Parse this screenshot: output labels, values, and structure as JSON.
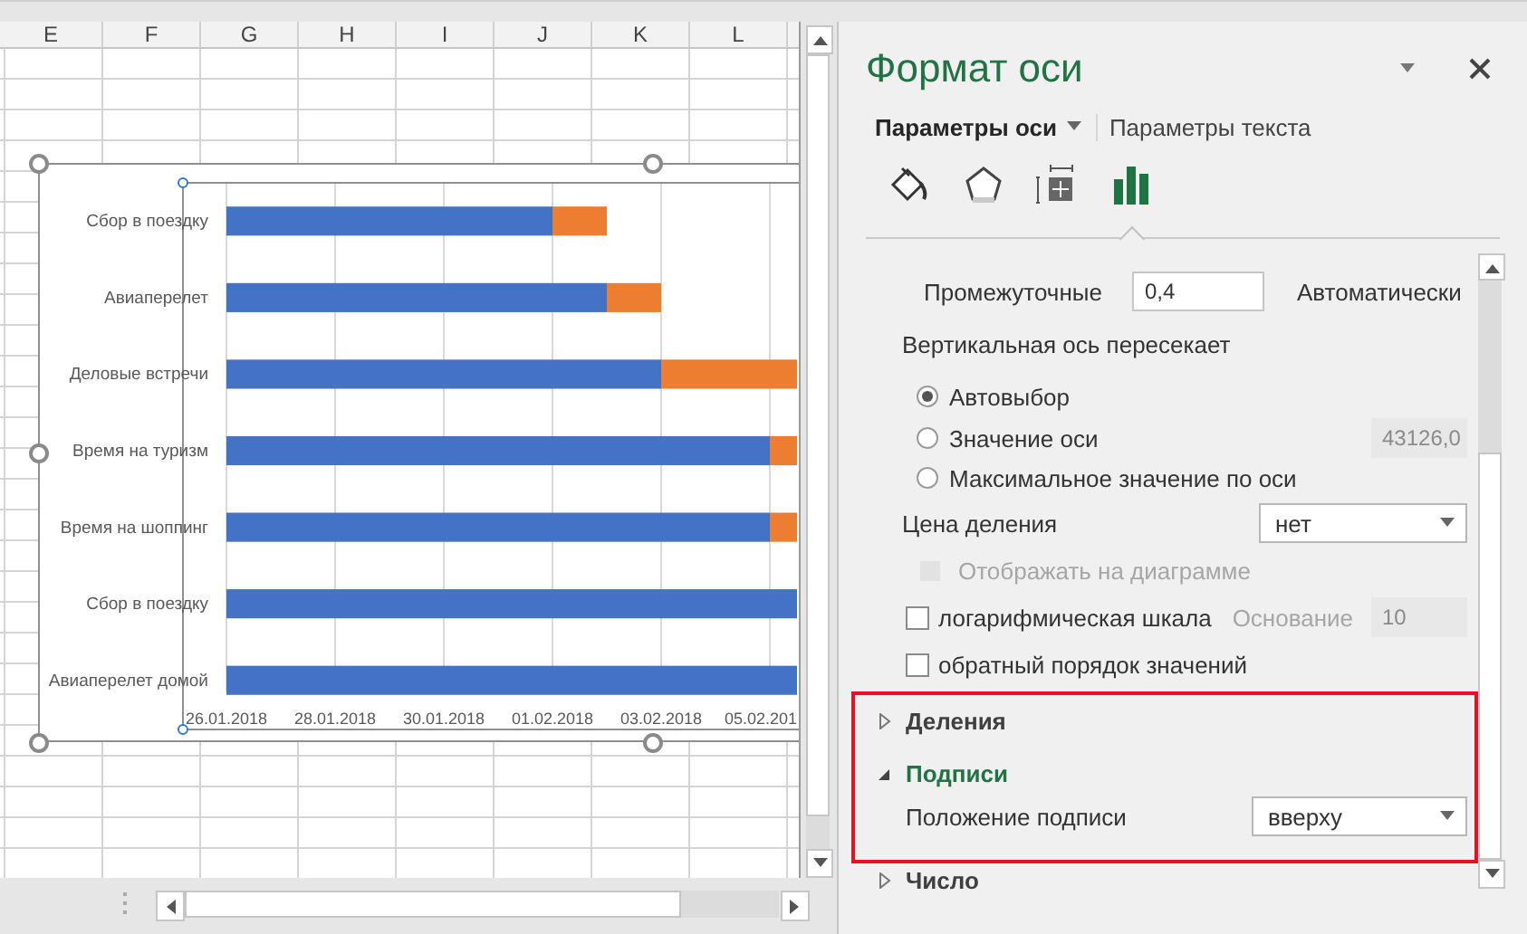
{
  "sheet": {
    "columns": [
      "E",
      "F",
      "G",
      "H",
      "I",
      "J",
      "K",
      "L"
    ]
  },
  "chart": {
    "categories": [
      "Сбор в поездку",
      "Авиаперелет",
      "Деловые встречи",
      "Время на туризм",
      "Время на шоппинг",
      "Сбор в поездку",
      "Авиаперелет домой"
    ],
    "axis_labels": [
      "26.01.2018",
      "28.01.2018",
      "30.01.2018",
      "01.02.2018",
      "03.02.2018",
      "05.02.201"
    ]
  },
  "panel": {
    "title": "Формат оси",
    "tabs": [
      {
        "label": "Параметры оси",
        "selected": true
      },
      {
        "label": "Параметры текста",
        "selected": false
      }
    ],
    "icon_tabs": [
      {
        "kind": "fill",
        "selected": false
      },
      {
        "kind": "effects",
        "selected": false
      },
      {
        "kind": "size",
        "selected": false
      },
      {
        "kind": "options",
        "selected": true
      }
    ],
    "options": [
      {
        "kind": "partial_field"
      },
      {
        "kind": "spin",
        "label": "Промежуточные",
        "field": {
          "value": "0,4",
          "disabled": false
        },
        "note": "Автоматически"
      },
      {
        "kind": "heading",
        "label": "Вертикальная ось пересекает"
      },
      {
        "kind": "radio",
        "label": "Автовыбор",
        "selected": true
      },
      {
        "kind": "radio",
        "label": "Значение оси",
        "selected": false,
        "field": {
          "value": "43126,0",
          "disabled": true
        }
      },
      {
        "kind": "radio",
        "label": "Максимальное значение по оси",
        "selected": false
      },
      {
        "kind": "select",
        "label": "Цена деления",
        "value": "нет"
      },
      {
        "kind": "sub_checkbox",
        "label": "Отображать на диаграмме",
        "checked": false,
        "disabled": true
      },
      {
        "kind": "checkbox",
        "label": "логарифмическая шкала",
        "checked": false,
        "disabled": false,
        "field_label": "Основание",
        "field": {
          "value": "10",
          "disabled": true
        }
      },
      {
        "kind": "checkbox",
        "label": "обратный порядок значений",
        "checked": false,
        "disabled": false
      }
    ],
    "sections": [
      {
        "label": "Деления",
        "expanded": false
      },
      {
        "label": "Подписи",
        "expanded": true,
        "rows": [
          {
            "kind": "select",
            "label": "Положение подписи",
            "value": "вверху"
          }
        ]
      },
      {
        "label": "Число",
        "expanded": false
      }
    ]
  }
}
